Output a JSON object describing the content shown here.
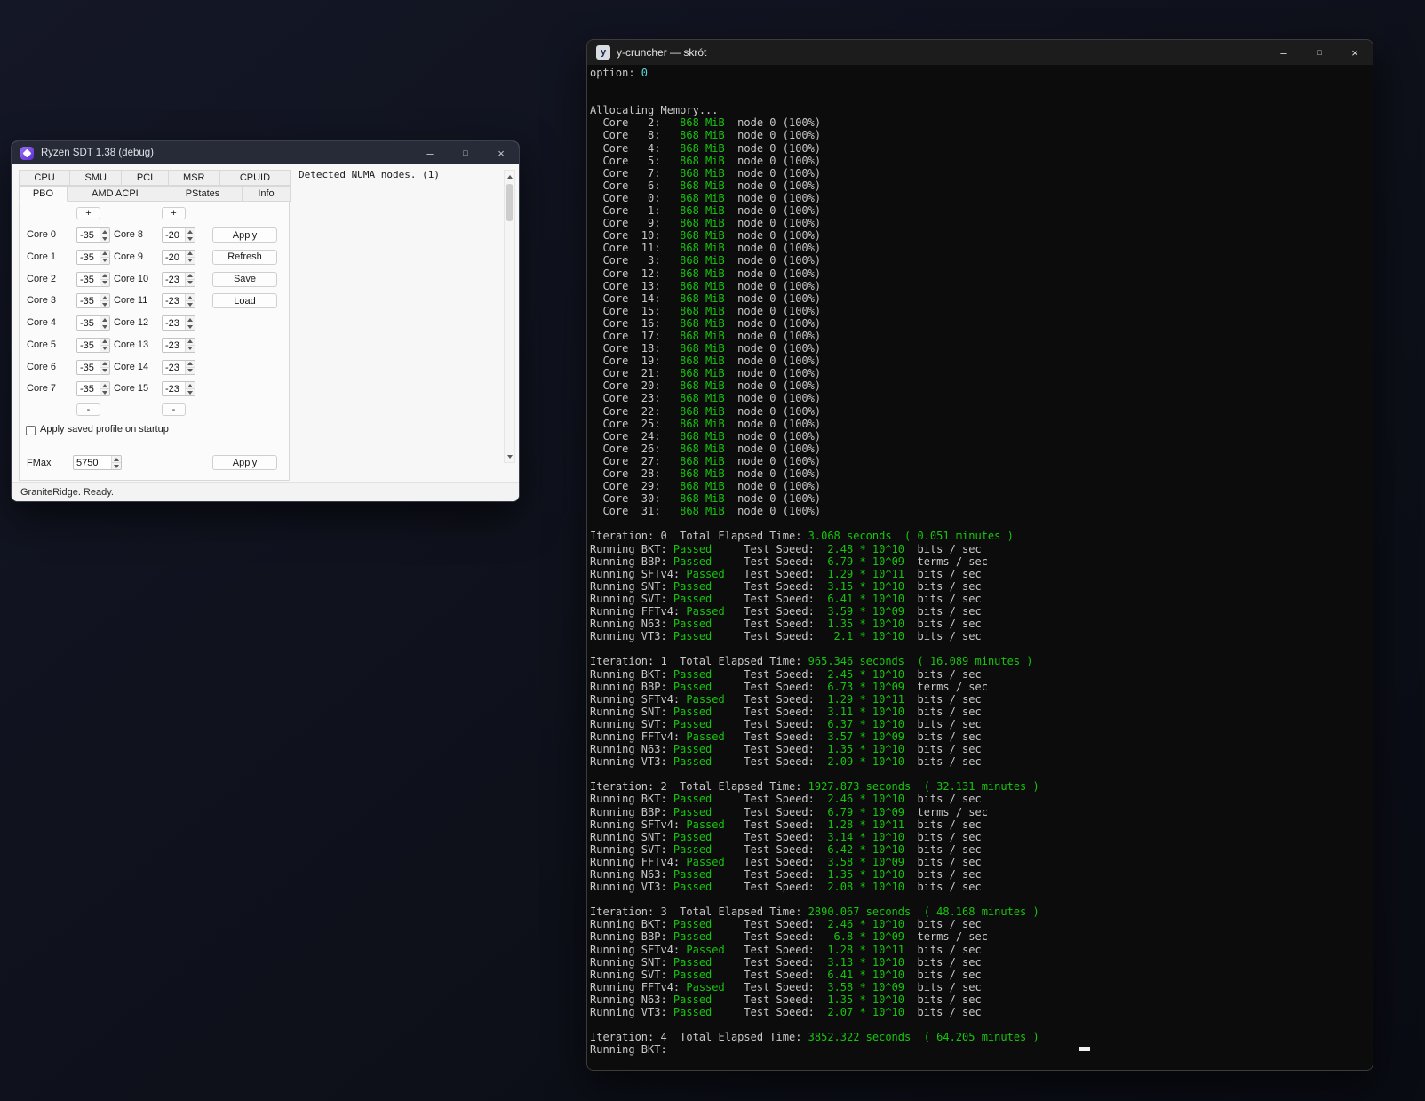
{
  "ryzen": {
    "title": "Ryzen SDT 1.38 (debug)",
    "controls": {
      "minimize": "–",
      "maximize": "□",
      "close": "×"
    },
    "tabs_row1": [
      "CPU",
      "SMU",
      "PCI",
      "MSR",
      "CPUID"
    ],
    "tabs_row2": [
      "PBO",
      "AMD ACPI",
      "PStates",
      "Info"
    ],
    "active_tab": "PBO",
    "plus": "+",
    "minus": "-",
    "cores": [
      {
        "left_label": "Core 0",
        "left_value": "-35",
        "right_label": "Core 8",
        "right_value": "-20"
      },
      {
        "left_label": "Core 1",
        "left_value": "-35",
        "right_label": "Core 9",
        "right_value": "-20"
      },
      {
        "left_label": "Core 2",
        "left_value": "-35",
        "right_label": "Core 10",
        "right_value": "-23"
      },
      {
        "left_label": "Core 3",
        "left_value": "-35",
        "right_label": "Core 11",
        "right_value": "-23"
      },
      {
        "left_label": "Core 4",
        "left_value": "-35",
        "right_label": "Core 12",
        "right_value": "-23"
      },
      {
        "left_label": "Core 5",
        "left_value": "-35",
        "right_label": "Core 13",
        "right_value": "-23"
      },
      {
        "left_label": "Core 6",
        "left_value": "-35",
        "right_label": "Core 14",
        "right_value": "-23"
      },
      {
        "left_label": "Core 7",
        "left_value": "-35",
        "right_label": "Core 15",
        "right_value": "-23"
      }
    ],
    "action_buttons": [
      "Apply",
      "Refresh",
      "Save",
      "Load"
    ],
    "checkbox_label": "Apply saved profile on startup",
    "checkbox_checked": false,
    "fmax": {
      "label": "FMax",
      "value": "5750",
      "apply": "Apply"
    },
    "status": "GraniteRidge. Ready.",
    "numa_text": "Detected NUMA nodes. (1)"
  },
  "ycruncher": {
    "title": "y-cruncher — skrót",
    "icon_letter": "y",
    "controls": {
      "minimize": "–",
      "maximize": "□",
      "close": "×"
    },
    "colors": {
      "bg": "#0c0c0c",
      "fg": "#c8c8c8",
      "green": "#16c60c",
      "cyan": "#5fd1d6"
    },
    "option_label": "option:",
    "option_value": "0",
    "allocating": "Allocating Memory...",
    "memory_per_core": "868 MiB",
    "node_text": "node 0 (100%)",
    "core_order": [
      "2",
      "8",
      "4",
      "5",
      "7",
      "6",
      "0",
      "1",
      "9",
      "10",
      "11",
      "3",
      "12",
      "13",
      "14",
      "15",
      "16",
      "17",
      "18",
      "19",
      "21",
      "20",
      "23",
      "22",
      "25",
      "24",
      "26",
      "27",
      "28",
      "29",
      "30",
      "31"
    ],
    "iteration_label": "Iteration:",
    "elapsed_label": "Total Elapsed Time:",
    "running_prefix": "Running",
    "test_speed_label": "Test Speed:",
    "iterations": [
      {
        "index": "0",
        "seconds": "3.068 seconds",
        "minutes": "( 0.051 minutes )",
        "tests": [
          {
            "name": "BKT",
            "status": "Passed",
            "speed": "2.48 * 10^10",
            "unit": "bits / sec"
          },
          {
            "name": "BBP",
            "status": "Passed",
            "speed": "6.79 * 10^09",
            "unit": "terms / sec"
          },
          {
            "name": "SFTv4",
            "status": "Passed",
            "speed": "1.29 * 10^11",
            "unit": "bits / sec"
          },
          {
            "name": "SNT",
            "status": "Passed",
            "speed": "3.15 * 10^10",
            "unit": "bits / sec"
          },
          {
            "name": "SVT",
            "status": "Passed",
            "speed": "6.41 * 10^10",
            "unit": "bits / sec"
          },
          {
            "name": "FFTv4",
            "status": "Passed",
            "speed": "3.59 * 10^09",
            "unit": "bits / sec"
          },
          {
            "name": "N63",
            "status": "Passed",
            "speed": "1.35 * 10^10",
            "unit": "bits / sec"
          },
          {
            "name": "VT3",
            "status": "Passed",
            "speed": "2.1 * 10^10",
            "unit": "bits / sec"
          }
        ]
      },
      {
        "index": "1",
        "seconds": "965.346 seconds",
        "minutes": "( 16.089 minutes )",
        "tests": [
          {
            "name": "BKT",
            "status": "Passed",
            "speed": "2.45 * 10^10",
            "unit": "bits / sec"
          },
          {
            "name": "BBP",
            "status": "Passed",
            "speed": "6.73 * 10^09",
            "unit": "terms / sec"
          },
          {
            "name": "SFTv4",
            "status": "Passed",
            "speed": "1.29 * 10^11",
            "unit": "bits / sec"
          },
          {
            "name": "SNT",
            "status": "Passed",
            "speed": "3.11 * 10^10",
            "unit": "bits / sec"
          },
          {
            "name": "SVT",
            "status": "Passed",
            "speed": "6.37 * 10^10",
            "unit": "bits / sec"
          },
          {
            "name": "FFTv4",
            "status": "Passed",
            "speed": "3.57 * 10^09",
            "unit": "bits / sec"
          },
          {
            "name": "N63",
            "status": "Passed",
            "speed": "1.35 * 10^10",
            "unit": "bits / sec"
          },
          {
            "name": "VT3",
            "status": "Passed",
            "speed": "2.09 * 10^10",
            "unit": "bits / sec"
          }
        ]
      },
      {
        "index": "2",
        "seconds": "1927.873 seconds",
        "minutes": "( 32.131 minutes )",
        "tests": [
          {
            "name": "BKT",
            "status": "Passed",
            "speed": "2.46 * 10^10",
            "unit": "bits / sec"
          },
          {
            "name": "BBP",
            "status": "Passed",
            "speed": "6.79 * 10^09",
            "unit": "terms / sec"
          },
          {
            "name": "SFTv4",
            "status": "Passed",
            "speed": "1.28 * 10^11",
            "unit": "bits / sec"
          },
          {
            "name": "SNT",
            "status": "Passed",
            "speed": "3.14 * 10^10",
            "unit": "bits / sec"
          },
          {
            "name": "SVT",
            "status": "Passed",
            "speed": "6.42 * 10^10",
            "unit": "bits / sec"
          },
          {
            "name": "FFTv4",
            "status": "Passed",
            "speed": "3.58 * 10^09",
            "unit": "bits / sec"
          },
          {
            "name": "N63",
            "status": "Passed",
            "speed": "1.35 * 10^10",
            "unit": "bits / sec"
          },
          {
            "name": "VT3",
            "status": "Passed",
            "speed": "2.08 * 10^10",
            "unit": "bits / sec"
          }
        ]
      },
      {
        "index": "3",
        "seconds": "2890.067 seconds",
        "minutes": "( 48.168 minutes )",
        "tests": [
          {
            "name": "BKT",
            "status": "Passed",
            "speed": "2.46 * 10^10",
            "unit": "bits / sec"
          },
          {
            "name": "BBP",
            "status": "Passed",
            "speed": "6.8 * 10^09",
            "unit": "terms / sec"
          },
          {
            "name": "SFTv4",
            "status": "Passed",
            "speed": "1.28 * 10^11",
            "unit": "bits / sec"
          },
          {
            "name": "SNT",
            "status": "Passed",
            "speed": "3.13 * 10^10",
            "unit": "bits / sec"
          },
          {
            "name": "SVT",
            "status": "Passed",
            "speed": "6.41 * 10^10",
            "unit": "bits / sec"
          },
          {
            "name": "FFTv4",
            "status": "Passed",
            "speed": "3.58 * 10^09",
            "unit": "bits / sec"
          },
          {
            "name": "N63",
            "status": "Passed",
            "speed": "1.35 * 10^10",
            "unit": "bits / sec"
          },
          {
            "name": "VT3",
            "status": "Passed",
            "speed": "2.07 * 10^10",
            "unit": "bits / sec"
          }
        ]
      },
      {
        "index": "4",
        "seconds": "3852.322 seconds",
        "minutes": "( 64.205 minutes )",
        "tests": [],
        "partial": "Running BKT:"
      }
    ]
  }
}
